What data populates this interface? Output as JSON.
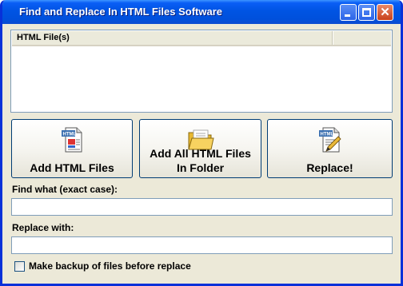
{
  "window": {
    "title": "Find and Replace In HTML Files Software"
  },
  "titlebar_buttons": {
    "minimize_icon": "minimize-icon",
    "maximize_icon": "maximize-icon",
    "close_icon": "close-icon",
    "close_glyph": "✕"
  },
  "file_list": {
    "columns": [
      "HTML File(s)",
      ""
    ],
    "rows": []
  },
  "buttons": {
    "add_files": {
      "label": "Add HTML Files",
      "icon": "html-file-icon"
    },
    "add_folder": {
      "label_line1": "Add All HTML Files",
      "label_line2": "In Folder",
      "icon": "folder-icon"
    },
    "replace": {
      "label": "Replace!",
      "icon": "html-edit-icon"
    }
  },
  "find": {
    "label": "Find what (exact case):",
    "value": ""
  },
  "replace_with": {
    "label": "Replace with:",
    "value": ""
  },
  "backup": {
    "label": "Make backup of files before replace",
    "checked": false
  },
  "colors": {
    "titlebar": "#0054e3",
    "window_bg": "#ece9d8",
    "border": "#7f9db9"
  }
}
